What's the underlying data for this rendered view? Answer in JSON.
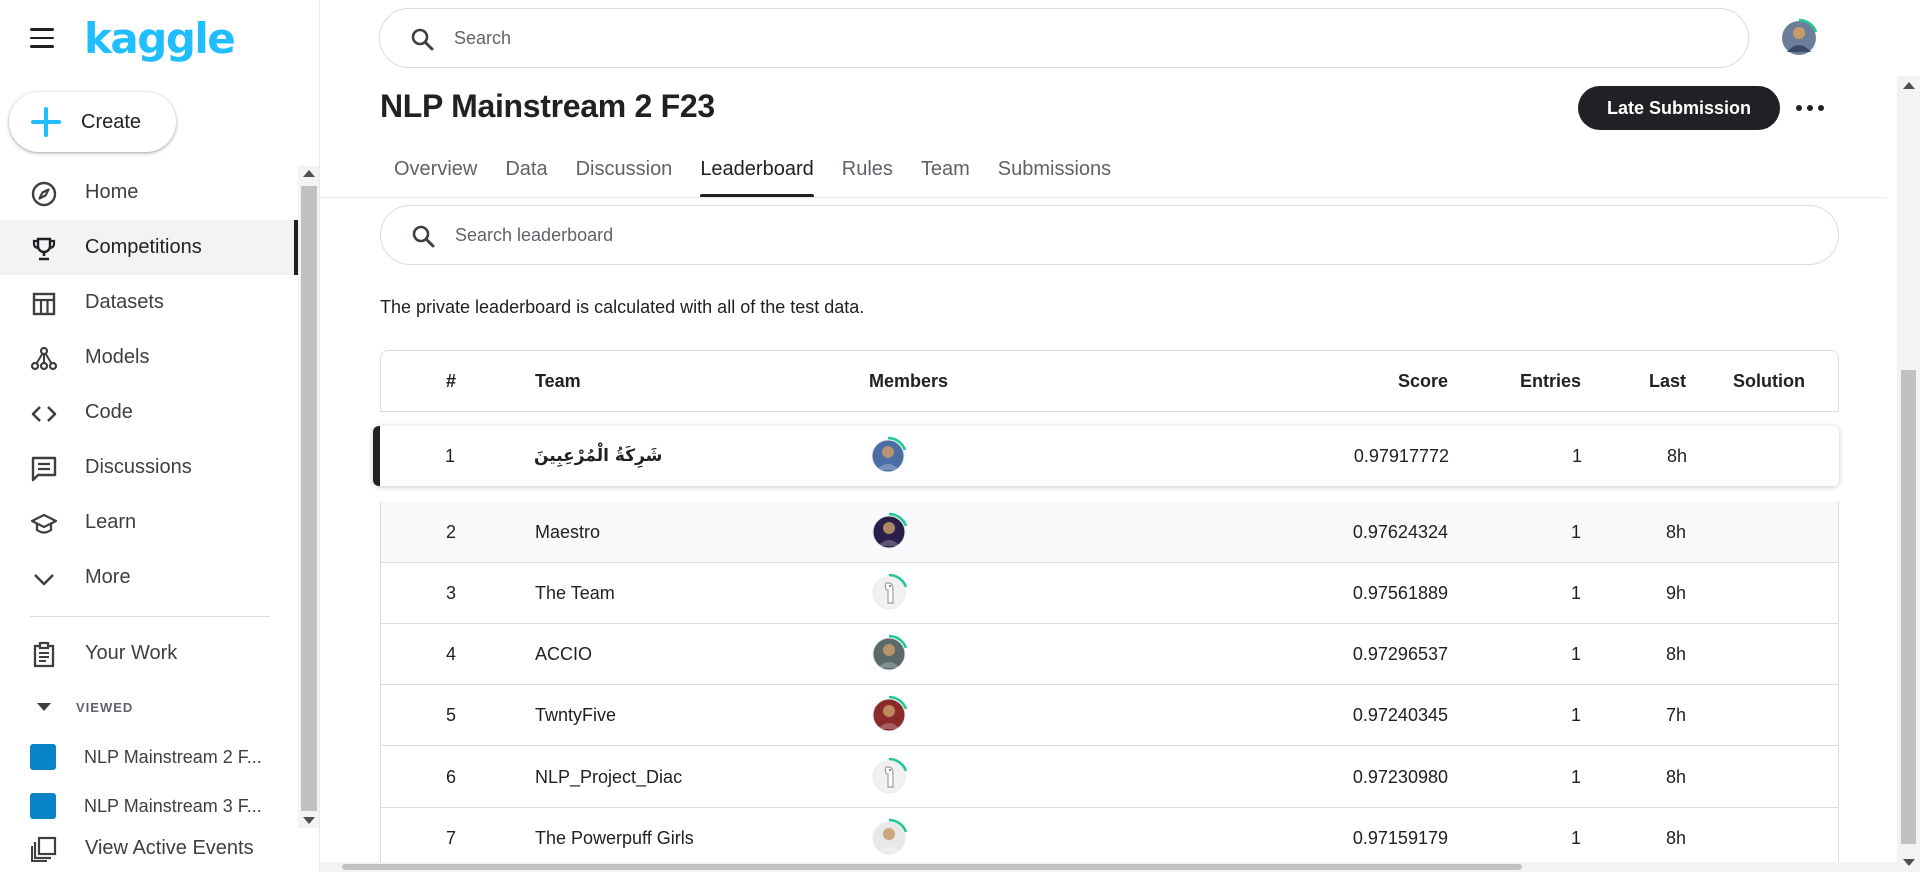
{
  "brand": {
    "logo_text": "kaggle",
    "accent_color": "#20beff"
  },
  "sidebar": {
    "create_label": "Create",
    "nav": [
      {
        "label": "Home",
        "icon": "compass-icon"
      },
      {
        "label": "Competitions",
        "icon": "trophy-icon",
        "active": true
      },
      {
        "label": "Datasets",
        "icon": "table-icon"
      },
      {
        "label": "Models",
        "icon": "models-icon"
      },
      {
        "label": "Code",
        "icon": "code-icon"
      },
      {
        "label": "Discussions",
        "icon": "discussions-icon"
      },
      {
        "label": "Learn",
        "icon": "learn-cap-icon"
      },
      {
        "label": "More",
        "icon": "chevron-down-icon"
      }
    ],
    "your_work": "Your Work",
    "viewed_header": "VIEWED",
    "viewed": [
      {
        "label": "NLP Mainstream 2 F..."
      },
      {
        "label": "NLP Mainstream 3 F..."
      }
    ],
    "view_active_events": "View Active Events"
  },
  "header": {
    "search_placeholder": "Search"
  },
  "competition": {
    "title": "NLP Mainstream 2 F23",
    "late_submission": "Late Submission",
    "tabs": [
      "Overview",
      "Data",
      "Discussion",
      "Leaderboard",
      "Rules",
      "Team",
      "Submissions"
    ],
    "active_tab": "Leaderboard"
  },
  "leaderboard": {
    "search_placeholder": "Search leaderboard",
    "note": "The private leaderboard is calculated with all of the test data.",
    "columns": {
      "rank": "#",
      "team": "Team",
      "members": "Members",
      "score": "Score",
      "entries": "Entries",
      "last": "Last",
      "solution": "Solution"
    },
    "rows": [
      {
        "rank": "1",
        "team": "شَرِكَةُ الْمُرْعِبِينَ",
        "score": "0.97917772",
        "entries": "1",
        "last": "8h",
        "avatar": "user-photo",
        "avatar_color": "#4a6fa5",
        "rtl": true
      },
      {
        "rank": "2",
        "team": "Maestro",
        "score": "0.97624324",
        "entries": "1",
        "last": "8h",
        "avatar": "user-photo",
        "avatar_color": "#2a1e4a"
      },
      {
        "rank": "3",
        "team": "The Team",
        "score": "0.97561889",
        "entries": "1",
        "last": "9h",
        "avatar": "default-goose",
        "avatar_color": "#f1f1f1"
      },
      {
        "rank": "4",
        "team": "ACCIO",
        "score": "0.97296537",
        "entries": "1",
        "last": "8h",
        "avatar": "user-photo",
        "avatar_color": "#5a6a6a"
      },
      {
        "rank": "5",
        "team": "TwntyFive",
        "score": "0.97240345",
        "entries": "1",
        "last": "7h",
        "avatar": "user-photo",
        "avatar_color": "#8a2a2a"
      },
      {
        "rank": "6",
        "team": "NLP_Project_Diac",
        "score": "0.97230980",
        "entries": "1",
        "last": "8h",
        "avatar": "default-goose",
        "avatar_color": "#f1f1f1"
      },
      {
        "rank": "7",
        "team": "The Powerpuff Girls",
        "score": "0.97159179",
        "entries": "1",
        "last": "8h",
        "avatar": "user-photo",
        "avatar_color": "#e8e8e8"
      }
    ]
  },
  "colors": {
    "ring": "#20c997",
    "text": "#202124",
    "muted": "#5f6368",
    "border": "#dadce0"
  }
}
